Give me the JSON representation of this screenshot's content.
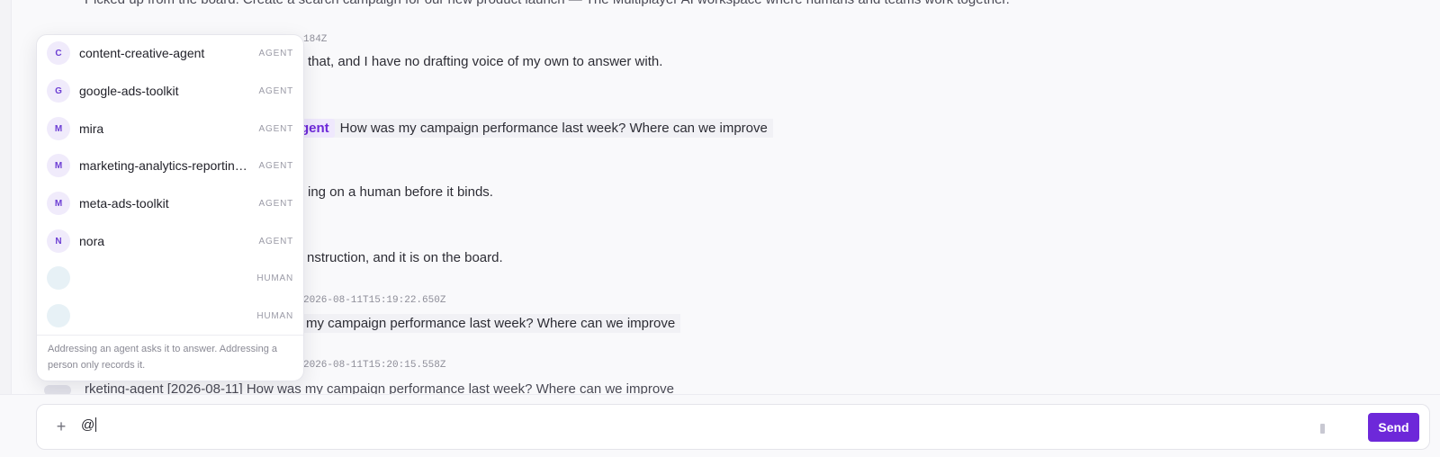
{
  "feed": {
    "top_cut_text": "Picked up from the board: Create a search campaign for our new product launch — The Multiplayer AI workspace where humans and teams work together.",
    "timestamps": [
      "184Z",
      "2026-08-11T15:19:22.650Z",
      "2026-08-11T15:20:15.558Z"
    ],
    "messages": [
      {
        "text": "that, and I have no drafting voice of my own to answer with."
      },
      {
        "mention": "gent",
        "text": "How was my campaign performance last week? Where can we improve"
      },
      {
        "text": "ing on a human before it binds."
      },
      {
        "text": "nstruction, and it is on the board."
      },
      {
        "text": "my campaign performance last week? Where can we improve"
      }
    ],
    "bottom_cut_text": "rketing-agent [2026-08-11] How was my campaign performance last week? Where can we improve"
  },
  "mention_popup": {
    "items": [
      {
        "initial": "C",
        "name": "content-creative-agent",
        "kind": "AGENT"
      },
      {
        "initial": "G",
        "name": "google-ads-toolkit",
        "kind": "AGENT"
      },
      {
        "initial": "M",
        "name": "mira",
        "kind": "AGENT"
      },
      {
        "initial": "M",
        "name": "marketing-analytics-reporting-agent",
        "kind": "AGENT"
      },
      {
        "initial": "M",
        "name": "meta-ads-toolkit",
        "kind": "AGENT"
      },
      {
        "initial": "N",
        "name": "nora",
        "kind": "AGENT"
      },
      {
        "initial": "",
        "name": "",
        "kind": "HUMAN"
      },
      {
        "initial": "",
        "name": "",
        "kind": "HUMAN"
      }
    ],
    "footer_text": "Addressing an agent asks it to answer. Addressing a person only records it."
  },
  "composer": {
    "plus_icon": "plus-icon",
    "input_value": "@",
    "send_label": "Send"
  },
  "colors": {
    "accent": "#6d28d9",
    "mention_bg": "#efe8fd",
    "agent_avatar_bg": "#f0ebfb",
    "human_avatar_bg": "#e7f1f6"
  }
}
